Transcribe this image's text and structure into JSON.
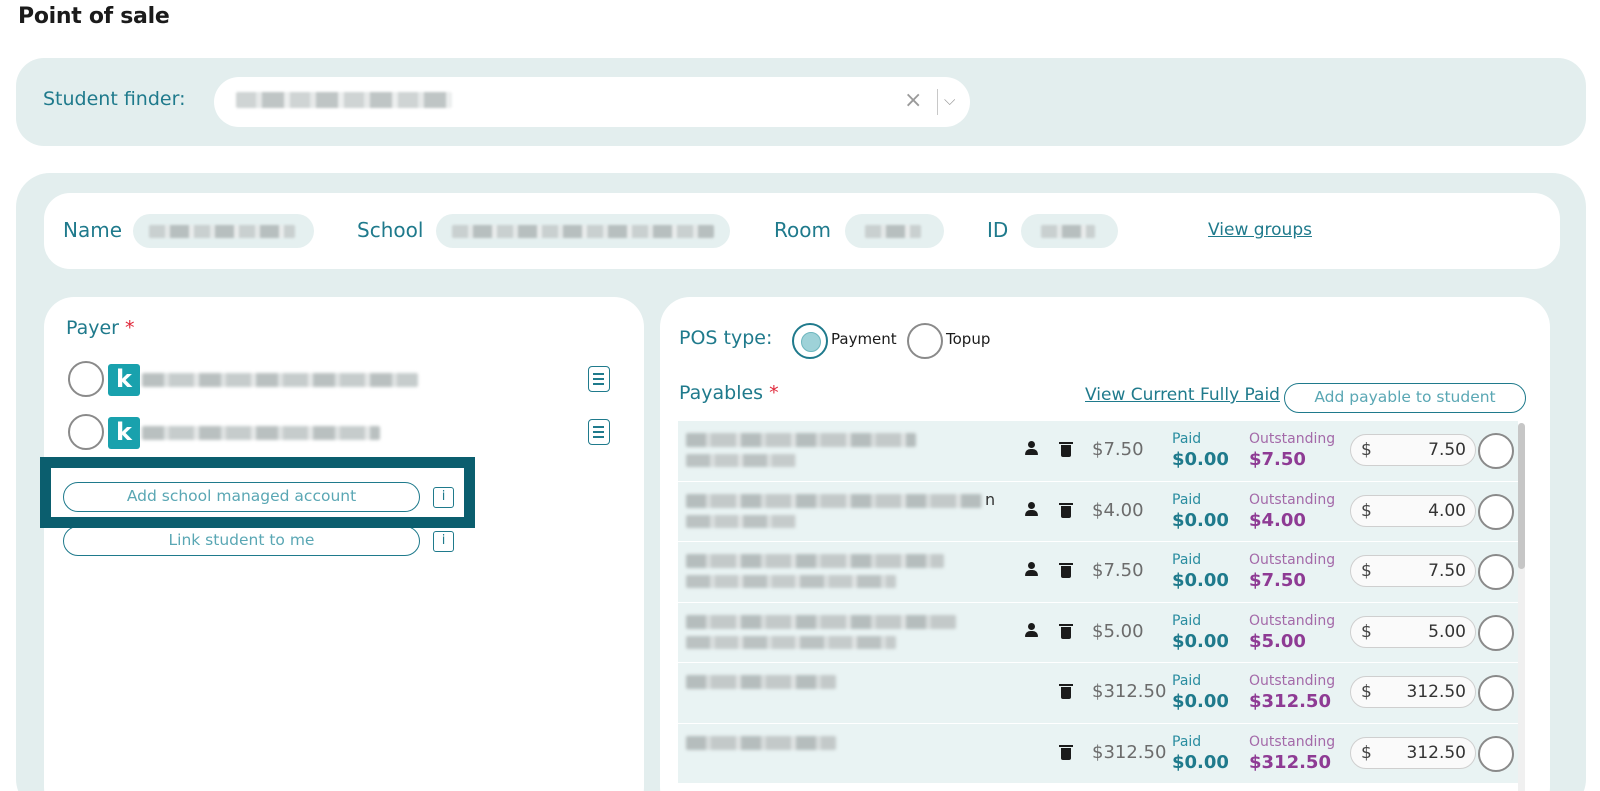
{
  "page": {
    "title": "Point of sale"
  },
  "finder": {
    "label": "Student finder:",
    "clear_icon": "×",
    "chevron_icon": "⌵"
  },
  "info": {
    "name_label": "Name",
    "school_label": "School",
    "room_label": "Room",
    "id_label": "ID",
    "view_groups": "View groups"
  },
  "payer": {
    "title": "Payer",
    "required_mark": "*",
    "badge_letter": "k",
    "add_school_account": "Add school managed account",
    "link_student": "Link student to me",
    "info_glyph": "i"
  },
  "pos": {
    "label": "POS type:",
    "options": [
      {
        "label": "Payment",
        "selected": true
      },
      {
        "label": "Topup",
        "selected": false
      }
    ]
  },
  "payables": {
    "title": "Payables",
    "required_mark": "*",
    "view_paid": "View Current Fully Paid",
    "add_button": "Add payable to student",
    "paid_label": "Paid",
    "outstanding_label": "Outstanding",
    "currency": "$",
    "rows": [
      {
        "amount": "$7.50",
        "paid": "$0.00",
        "outstanding": "$7.50",
        "input": "7.50",
        "has_person": true
      },
      {
        "amount": "$4.00",
        "paid": "$0.00",
        "outstanding": "$4.00",
        "input": "4.00",
        "has_person": true,
        "desc_tail": "n"
      },
      {
        "amount": "$7.50",
        "paid": "$0.00",
        "outstanding": "$7.50",
        "input": "7.50",
        "has_person": true
      },
      {
        "amount": "$5.00",
        "paid": "$0.00",
        "outstanding": "$5.00",
        "input": "5.00",
        "has_person": true
      },
      {
        "amount": "$312.50",
        "paid": "$0.00",
        "outstanding": "$312.50",
        "input": "312.50",
        "has_person": false
      },
      {
        "amount": "$312.50",
        "paid": "$0.00",
        "outstanding": "$312.50",
        "input": "312.50",
        "has_person": false
      }
    ]
  },
  "colors": {
    "teal": "#1f7a8c",
    "panel_bg": "#e3eeee",
    "outstanding_purple": "#8e3b94",
    "highlight_border": "#0b5e6e",
    "badge": "#19a1ad",
    "required": "#e0283a"
  }
}
